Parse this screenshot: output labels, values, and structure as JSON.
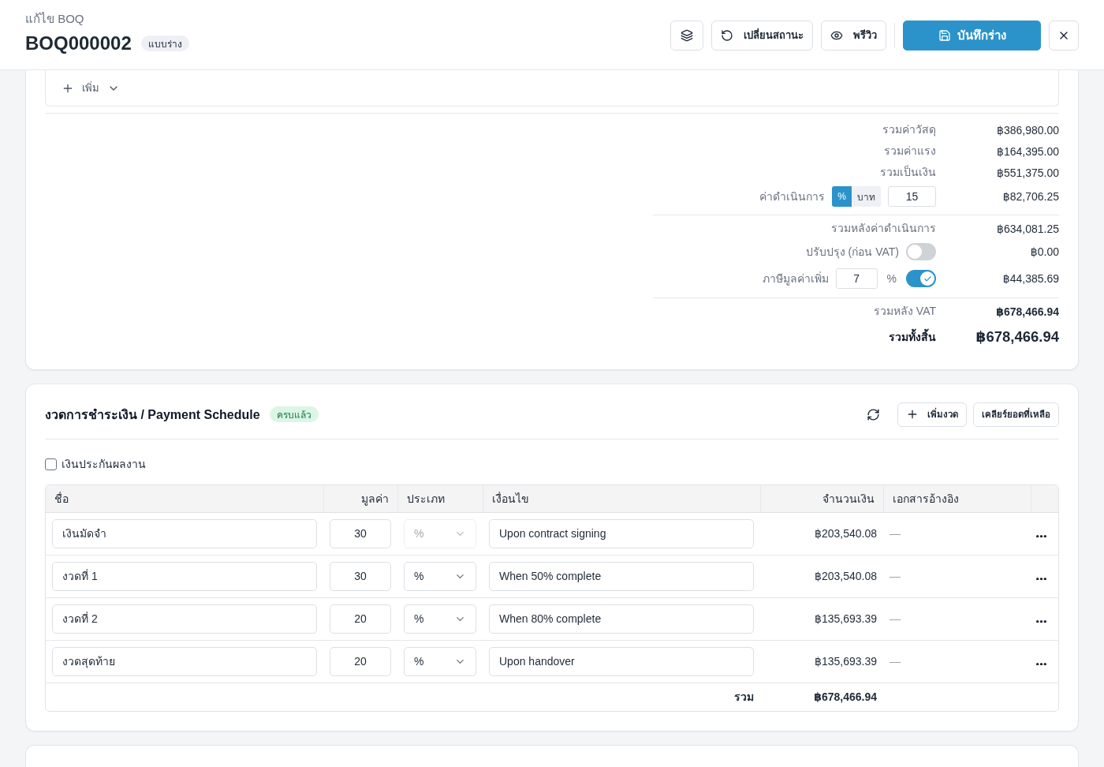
{
  "header": {
    "breadcrumb": "แก้ไข BOQ",
    "title": "BOQ000002",
    "badge": "แบบร่าง",
    "status_button": {
      "label": "เปลี่ยนสถานะ"
    },
    "preview_button": {
      "label": "พรีวิว"
    },
    "save_button": {
      "label": "บันทึกร่าง"
    }
  },
  "items": {
    "add_button": {
      "label": "เพิ่ม"
    }
  },
  "summary": {
    "sections": [
      {
        "rows": [
          {
            "kind": "amount",
            "label": "รวมค่าวัสดุ",
            "value": "฿386,980.00"
          },
          {
            "kind": "amount",
            "label": "รวมค่าแรง",
            "value": "฿164,395.00"
          },
          {
            "kind": "amount",
            "label": "รวมเป็นเงิน",
            "value": "฿551,375.00"
          },
          {
            "kind": "fee",
            "label": "ค่าดำเนินการ",
            "units": [
              {
                "label": "%",
                "selected": true
              },
              {
                "label": "บาท",
                "selected": false
              }
            ],
            "input": "15",
            "value": "฿82,706.25"
          }
        ]
      },
      {
        "rows": [
          {
            "kind": "amount",
            "label": "รวมหลังค่าดำเนินการ",
            "value": "฿634,081.25"
          },
          {
            "kind": "switch",
            "label": "ปรับปรุง (ก่อน VAT)",
            "on": false,
            "value": "฿0.00"
          },
          {
            "kind": "switch",
            "label": "ภาษีมูลค่าเพิ่ม",
            "input": "7",
            "unit": "%",
            "on": true,
            "value": "฿44,385.69"
          }
        ]
      },
      {
        "rows": [
          {
            "kind": "total",
            "label": "รวมหลัง VAT",
            "value": "฿678,466.94"
          },
          {
            "kind": "grand",
            "label": "รวมทั้งสิ้น",
            "value": "฿678,466.94"
          }
        ]
      }
    ]
  },
  "payment_schedule": {
    "title": "งวดการชำระเงิน / Payment Schedule",
    "badge": "ครบแล้ว",
    "add_button": {
      "label": "เพิ่มงวด"
    },
    "clear_button": {
      "label": "เคลียร์ยอดที่เหลือ"
    },
    "retention": {
      "label": "เงินประกันผลงาน",
      "checked": false
    },
    "table": {
      "columns": [
        {
          "label": "ชื่อ",
          "kind": "text"
        },
        {
          "label": "มูลค่า",
          "kind": "number"
        },
        {
          "label": "ประเภท",
          "kind": "text"
        },
        {
          "label": "เงื่อนไข",
          "kind": "text"
        },
        {
          "label": "จำนวนเงิน",
          "kind": "number"
        },
        {
          "label": "เอกสารอ้างอิง",
          "kind": "text"
        }
      ],
      "rows": [
        {
          "name": "เงินมัดจำ",
          "value": "30",
          "type": {
            "value": "%",
            "disabled": true
          },
          "condition": "Upon contract signing",
          "amount": "฿203,540.08",
          "reference": "—"
        },
        {
          "name": "งวดที่ 1",
          "value": "30",
          "type": {
            "value": "%",
            "disabled": false
          },
          "condition": "When 50% complete",
          "amount": "฿203,540.08",
          "reference": "—"
        },
        {
          "name": "งวดที่ 2",
          "value": "20",
          "type": {
            "value": "%",
            "disabled": false
          },
          "condition": "When 80% complete",
          "amount": "฿135,693.39",
          "reference": "—"
        },
        {
          "name": "งวดสุดท้าย",
          "value": "20",
          "type": {
            "value": "%",
            "disabled": false
          },
          "condition": "Upon handover",
          "amount": "฿135,693.39",
          "reference": "—"
        }
      ],
      "total": {
        "label": "รวม",
        "amount": "฿678,466.94"
      }
    }
  }
}
